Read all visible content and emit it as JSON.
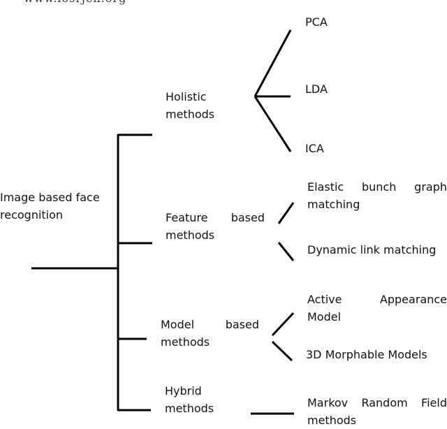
{
  "watermark": "www.iosrjen.org",
  "root": {
    "line1": "Image based face",
    "line2": "recognition"
  },
  "categories": [
    {
      "id": "holistic",
      "line1a": "Holistic",
      "line1b": "",
      "line2": "methods",
      "children": [
        {
          "line1": "PCA"
        },
        {
          "line1": "LDA"
        },
        {
          "line1": "ICA"
        }
      ]
    },
    {
      "id": "feature",
      "line1a": "Feature",
      "line1b": "based",
      "line2": "methods",
      "children": [
        {
          "line1a": "Elastic",
          "line1b": "bunch",
          "line1c": "graph",
          "line2": "matching"
        },
        {
          "line1": "Dynamic link matching"
        }
      ]
    },
    {
      "id": "model",
      "line1a": "Model",
      "line1b": "based",
      "line2": "methods",
      "children": [
        {
          "line1a": "Active",
          "line1b": "Appearance",
          "line2": "Model"
        },
        {
          "line1": "3D Morphable Models"
        }
      ]
    },
    {
      "id": "hybrid",
      "line1a": "Hybrid",
      "line1b": "",
      "line2": "methods",
      "children": [
        {
          "line1a": "Markov",
          "line1b": "Random",
          "line1c": "Field",
          "line2": "methods"
        }
      ]
    }
  ]
}
